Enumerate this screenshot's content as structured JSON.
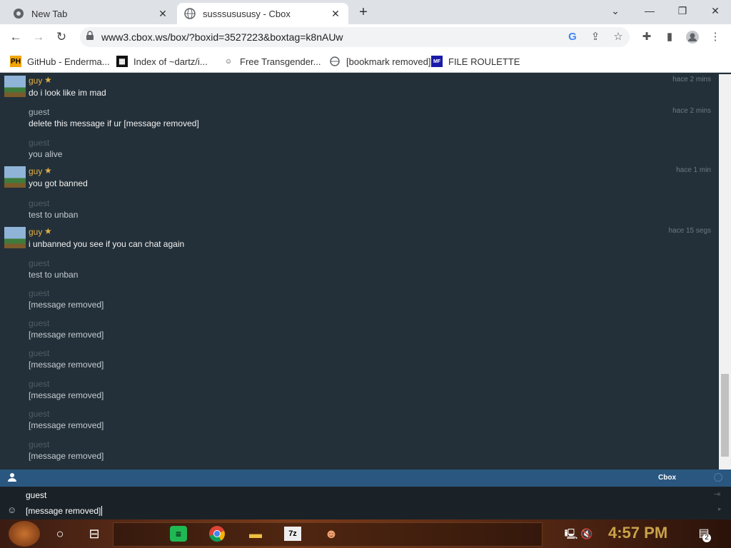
{
  "browser": {
    "tabs": [
      {
        "title": "New Tab"
      },
      {
        "title": "susssusususy - Cbox"
      }
    ],
    "url": "www3.cbox.ws/box/?boxid=3527223&boxtag=k8nAUw",
    "bookmarks": [
      {
        "label": "GitHub - Enderma..."
      },
      {
        "label": "Index of ~dartz/i..."
      },
      {
        "label": "Free Transgender..."
      },
      {
        "label": "[bookmark removed]"
      },
      {
        "label": "FILE ROULETTE"
      }
    ]
  },
  "chat": {
    "messages": [
      {
        "user": "guy",
        "star": true,
        "text": "do i look like im mad",
        "time": "hace 2 mins"
      },
      {
        "user": "guest",
        "text": "delete this message if ur [message removed]",
        "time": "hace 2 mins"
      },
      {
        "user": "guest",
        "text": "you alive",
        "time": ""
      },
      {
        "user": "guy",
        "star": true,
        "text": "you got banned",
        "time": "hace 1 min"
      },
      {
        "user": "guest",
        "text": "test to unban",
        "time": ""
      },
      {
        "user": "guy",
        "star": true,
        "text": "i unbanned you see if you can chat again",
        "time": "hace 15 segs"
      },
      {
        "user": "guest",
        "text": "test to unban",
        "time": ""
      },
      {
        "user": "guest",
        "text": "[message removed]",
        "time": ""
      },
      {
        "user": "guest",
        "text": "[message removed]",
        "time": ""
      },
      {
        "user": "guest",
        "text": "[message removed]",
        "time": ""
      },
      {
        "user": "guest",
        "text": "[message removed]",
        "time": ""
      },
      {
        "user": "guest",
        "text": "[message removed]",
        "time": ""
      },
      {
        "user": "guest",
        "text": "[message removed]",
        "time": ""
      }
    ]
  },
  "footer": {
    "brand": "Cbox",
    "name_value": "guest",
    "message_value": "[message removed]"
  },
  "taskbar": {
    "time": "4:57 PM",
    "notification_count": "2"
  }
}
